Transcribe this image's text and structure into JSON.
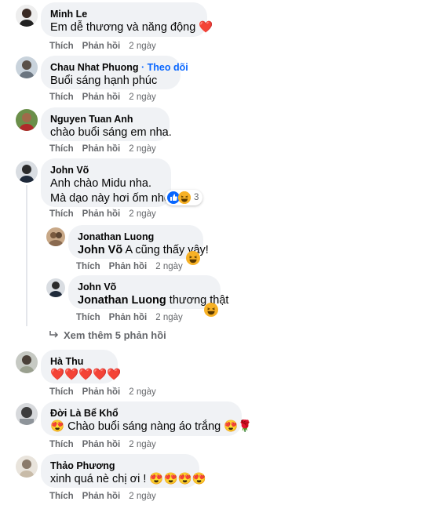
{
  "actions": {
    "like": "Thích",
    "reply": "Phản hồi"
  },
  "comments": [
    {
      "author": "Minh Le",
      "text": "Em dễ thương và năng động",
      "emoji": "❤️",
      "time": "2 ngày"
    },
    {
      "author": "Chau Nhat Phuong",
      "follow": "· Theo dõi",
      "text": "Buổi sáng hạnh phúc",
      "time": "2 ngày"
    },
    {
      "author": "Nguyen Tuan Anh",
      "text": "chào buổi sáng em nha.",
      "time": "2 ngày"
    },
    {
      "author": "John Võ",
      "text_line1": "Anh chào Midu nha.",
      "text_line2": "Mà dạo này hơi ốm nhé.",
      "reaction_count": "3",
      "time": "2 ngày",
      "replies": [
        {
          "author": "Jonathan Luong",
          "mention": "John Võ",
          "text": "A cũng thấy vậy!",
          "time": "2 ngày"
        },
        {
          "author": "John Võ",
          "mention": "Jonathan Luong",
          "text": "thương thật",
          "time": "2 ngày"
        }
      ],
      "view_more": "Xem thêm 5 phản hồi"
    },
    {
      "author": "Hà Thu",
      "text": "❤️❤️❤️❤️❤️",
      "time": "2 ngày"
    },
    {
      "author": "Đời Là Bể Khổ",
      "text": "Chào buổi sáng nàng áo trắng",
      "emoji_before": "😍",
      "emoji_after": "😍🌹",
      "time": "2 ngày"
    },
    {
      "author": "Thảo Phương",
      "text": "xinh quá nè chị ơi !",
      "emoji_after": "😍😍😍😍",
      "time": "2 ngày"
    }
  ]
}
